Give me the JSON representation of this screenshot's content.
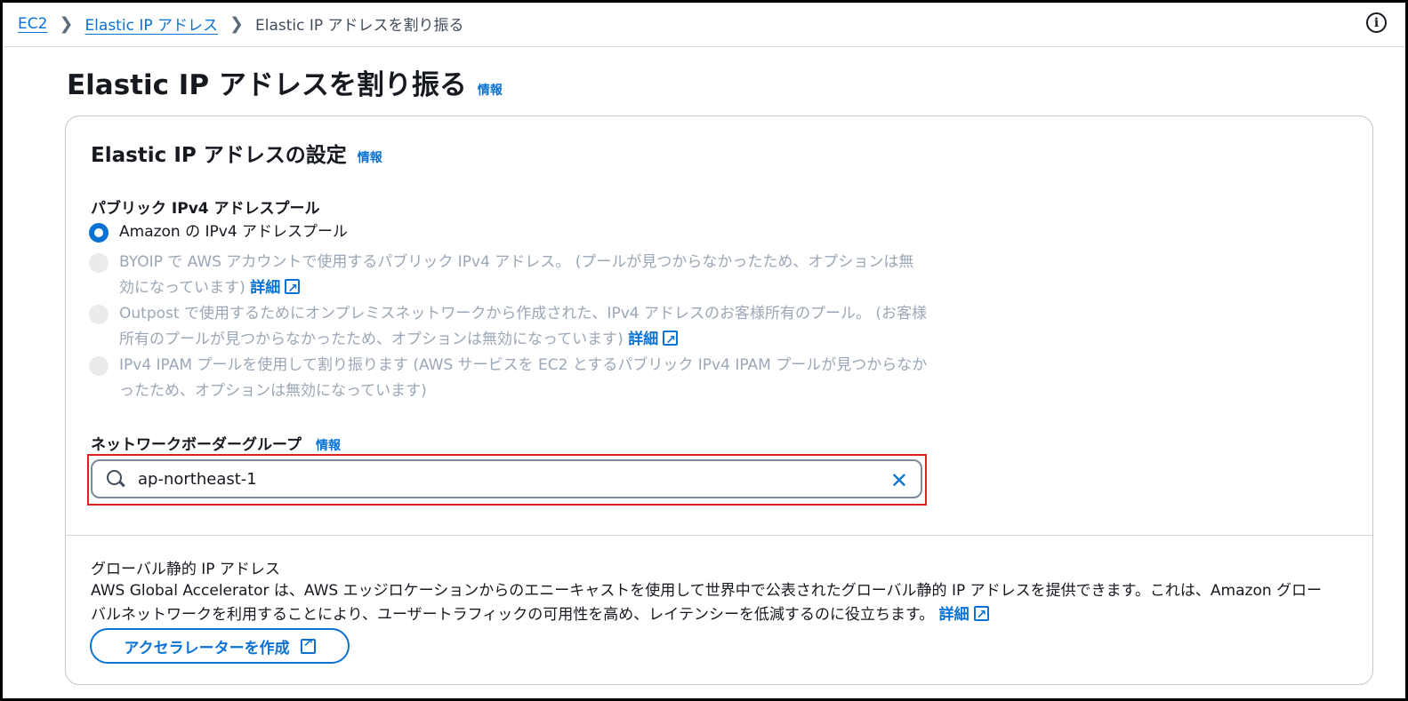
{
  "breadcrumb": {
    "items": [
      "EC2",
      "Elastic IP アドレス"
    ],
    "current": "Elastic IP アドレスを割り振る"
  },
  "page": {
    "title": "Elastic IP アドレスを割り振る",
    "info": "情報"
  },
  "settings": {
    "title": "Elastic IP アドレスの設定",
    "info": "情報",
    "pool_label": "パブリック IPv4 アドレスプール",
    "options": [
      {
        "text": "Amazon の IPv4 アドレスプール",
        "checked": true
      },
      {
        "text": "BYOIP で AWS アカウントで使用するパブリック IPv4 アドレス。 (プールが見つからなかったため、オプションは無効になっています)",
        "link": "詳細"
      },
      {
        "text": "Outpost で使用するためにオンプレミスネットワークから作成された、IPv4 アドレスのお客様所有のプール。 (お客様所有のプールが見つからなかったため、オプションは無効になっています)",
        "link": "詳細"
      },
      {
        "text": "IPv4 IPAM プールを使用して割り振ります (AWS サービスを EC2 とするパブリック IPv4 IPAM プールが見つからなかったため、オプションは無効になっています)"
      }
    ],
    "nbg_label": "ネットワークボーダーグループ",
    "nbg_info": "情報",
    "nbg_value": "ap-northeast-1"
  },
  "global_ip": {
    "heading": "グローバル静的 IP アドレス",
    "description": "AWS Global Accelerator は、AWS エッジロケーションからのエニーキャストを使用して世界中で公表されたグローバル静的 IP アドレスを提供できます。これは、Amazon グローバルネットワークを利用することにより、ユーザートラフィックの可用性を高め、レイテンシーを低減するのに役立ちます。",
    "link": "詳細",
    "button": "アクセラレーターを作成"
  },
  "colors": {
    "link": "#0972d3",
    "highlight": "#e0201e",
    "disabled_text": "#9ba7b6"
  }
}
